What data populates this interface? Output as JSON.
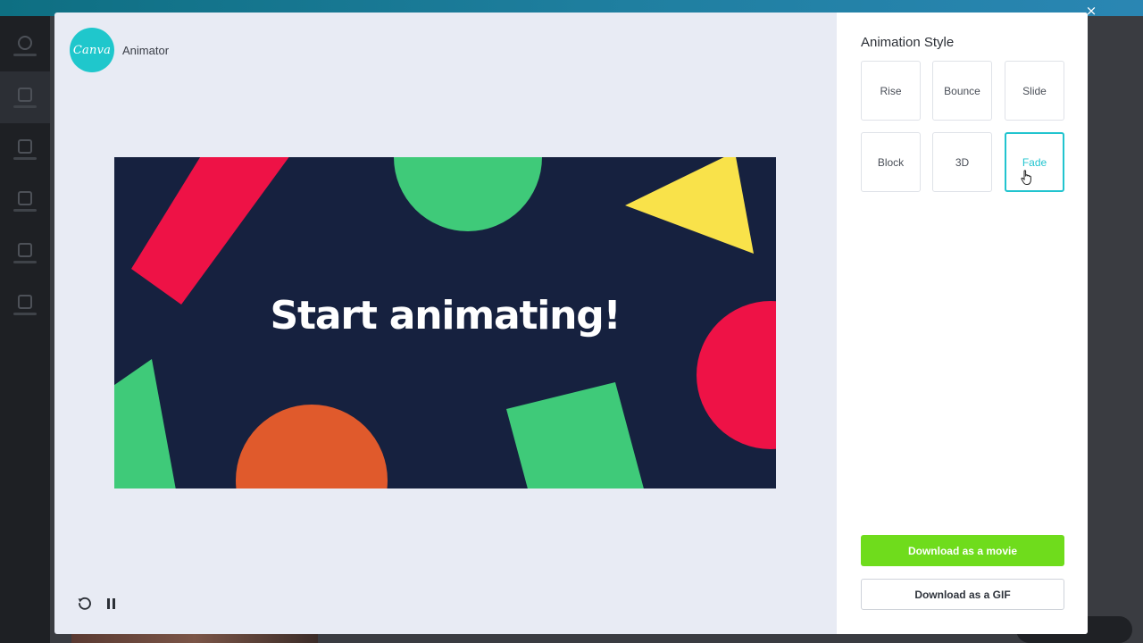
{
  "modal": {
    "close_label": "×",
    "app": {
      "logo_text": "Canva",
      "name": "Animator"
    },
    "preview": {
      "headline": "Start animating!",
      "background_color": "#16213f",
      "shape_colors": {
        "red": "#ee1246",
        "green": "#3fca79",
        "yellow": "#f9e24a",
        "orange": "#e05a2c"
      }
    },
    "controls": {
      "replay_icon": "replay-icon",
      "pause_icon": "pause-icon"
    }
  },
  "panel": {
    "title": "Animation Style",
    "styles": [
      {
        "label": "Rise",
        "selected": false
      },
      {
        "label": "Bounce",
        "selected": false
      },
      {
        "label": "Slide",
        "selected": false
      },
      {
        "label": "Block",
        "selected": false
      },
      {
        "label": "3D",
        "selected": false
      },
      {
        "label": "Fade",
        "selected": true
      }
    ],
    "accent_color": "#21c4cf",
    "download_movie_label": "Download as a movie",
    "download_movie_color": "#6fdc1c",
    "download_gif_label": "Download as a GIF"
  }
}
